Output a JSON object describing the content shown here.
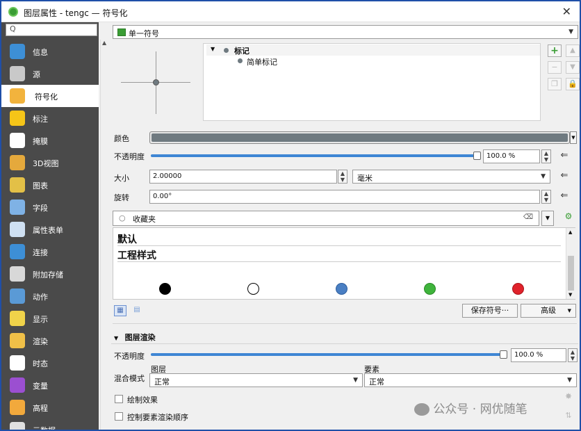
{
  "window": {
    "title": "图层属性 - tengc — 符号化",
    "close": "✕"
  },
  "sidebar": {
    "search_icon": "Q",
    "items": [
      {
        "label": "信息",
        "icon": "info-icon",
        "color": "#3d8fd6"
      },
      {
        "label": "源",
        "icon": "source-icon",
        "color": "#c9c9c9"
      },
      {
        "label": "符号化",
        "icon": "symbology-icon",
        "color": "#f2b33d",
        "active": true
      },
      {
        "label": "标注",
        "icon": "labels-icon",
        "color": "#f5c518"
      },
      {
        "label": "掩膜",
        "icon": "mask-icon",
        "color": "#ffffff"
      },
      {
        "label": "3D视图",
        "icon": "3d-view-icon",
        "color": "#e5a93c"
      },
      {
        "label": "图表",
        "icon": "diagrams-icon",
        "color": "#e3c047"
      },
      {
        "label": "字段",
        "icon": "fields-icon",
        "color": "#7fb2e5"
      },
      {
        "label": "属性表单",
        "icon": "attribute-form-icon",
        "color": "#cfe0f2"
      },
      {
        "label": "连接",
        "icon": "joins-icon",
        "color": "#3d8fd6"
      },
      {
        "label": "附加存储",
        "icon": "aux-storage-icon",
        "color": "#d8d8d8"
      },
      {
        "label": "动作",
        "icon": "actions-icon",
        "color": "#5a9ad6"
      },
      {
        "label": "显示",
        "icon": "display-icon",
        "color": "#f0d34a"
      },
      {
        "label": "渲染",
        "icon": "rendering-icon",
        "color": "#f0c048"
      },
      {
        "label": "时态",
        "icon": "temporal-icon",
        "color": "#ffffff"
      },
      {
        "label": "变量",
        "icon": "variables-icon",
        "color": "#9b4fd1"
      },
      {
        "label": "高程",
        "icon": "elevation-icon",
        "color": "#f2a93c"
      },
      {
        "label": "元数据",
        "icon": "metadata-icon",
        "color": "#e0e0e0"
      }
    ]
  },
  "renderer": {
    "selected": "单一符号",
    "icon_color": "#3a9d34"
  },
  "tree": {
    "root": "标记",
    "child": "简单标记",
    "toggle": "▼"
  },
  "color_row": {
    "label": "颜色",
    "value_color": "#6f7a80"
  },
  "opacity_row": {
    "label": "不透明度",
    "value": "100.0 %",
    "fraction": 1.0
  },
  "size_row": {
    "label": "大小",
    "value": "2.00000",
    "unit": "毫米"
  },
  "rotation_row": {
    "label": "旋转",
    "value": "0.00°"
  },
  "library_search": {
    "placeholder": "收藏夹"
  },
  "library": {
    "groups": [
      "默认",
      "工程样式"
    ],
    "swatches": [
      {
        "name": "black-dot",
        "fill": "#000000",
        "stroke": "#000000"
      },
      {
        "name": "white-dot",
        "fill": "#ffffff",
        "stroke": "#000000"
      },
      {
        "name": "blue-dot",
        "fill": "#4a7fc3",
        "stroke": "#2f5f9e"
      },
      {
        "name": "green-dot",
        "fill": "#3fb43c",
        "stroke": "#2a8a27"
      },
      {
        "name": "red-dot",
        "fill": "#e0222b",
        "stroke": "#a8141a"
      }
    ]
  },
  "buttons": {
    "save_symbol": "保存符号···",
    "advanced": "高级",
    "advanced_arrow": "▼"
  },
  "layer_rendering": {
    "title": "图层渲染",
    "opacity_label": "不透明度",
    "opacity_value": "100.0 %",
    "opacity_fraction": 1.0,
    "blend_label": "混合模式",
    "layer_label": "图层",
    "feature_label": "要素",
    "layer_mode": "正常",
    "feature_mode": "正常",
    "draw_effects": "绘制效果",
    "control_order": "控制要素渲染顺序"
  },
  "watermark": {
    "text": "公众号 · 网优随笔"
  }
}
